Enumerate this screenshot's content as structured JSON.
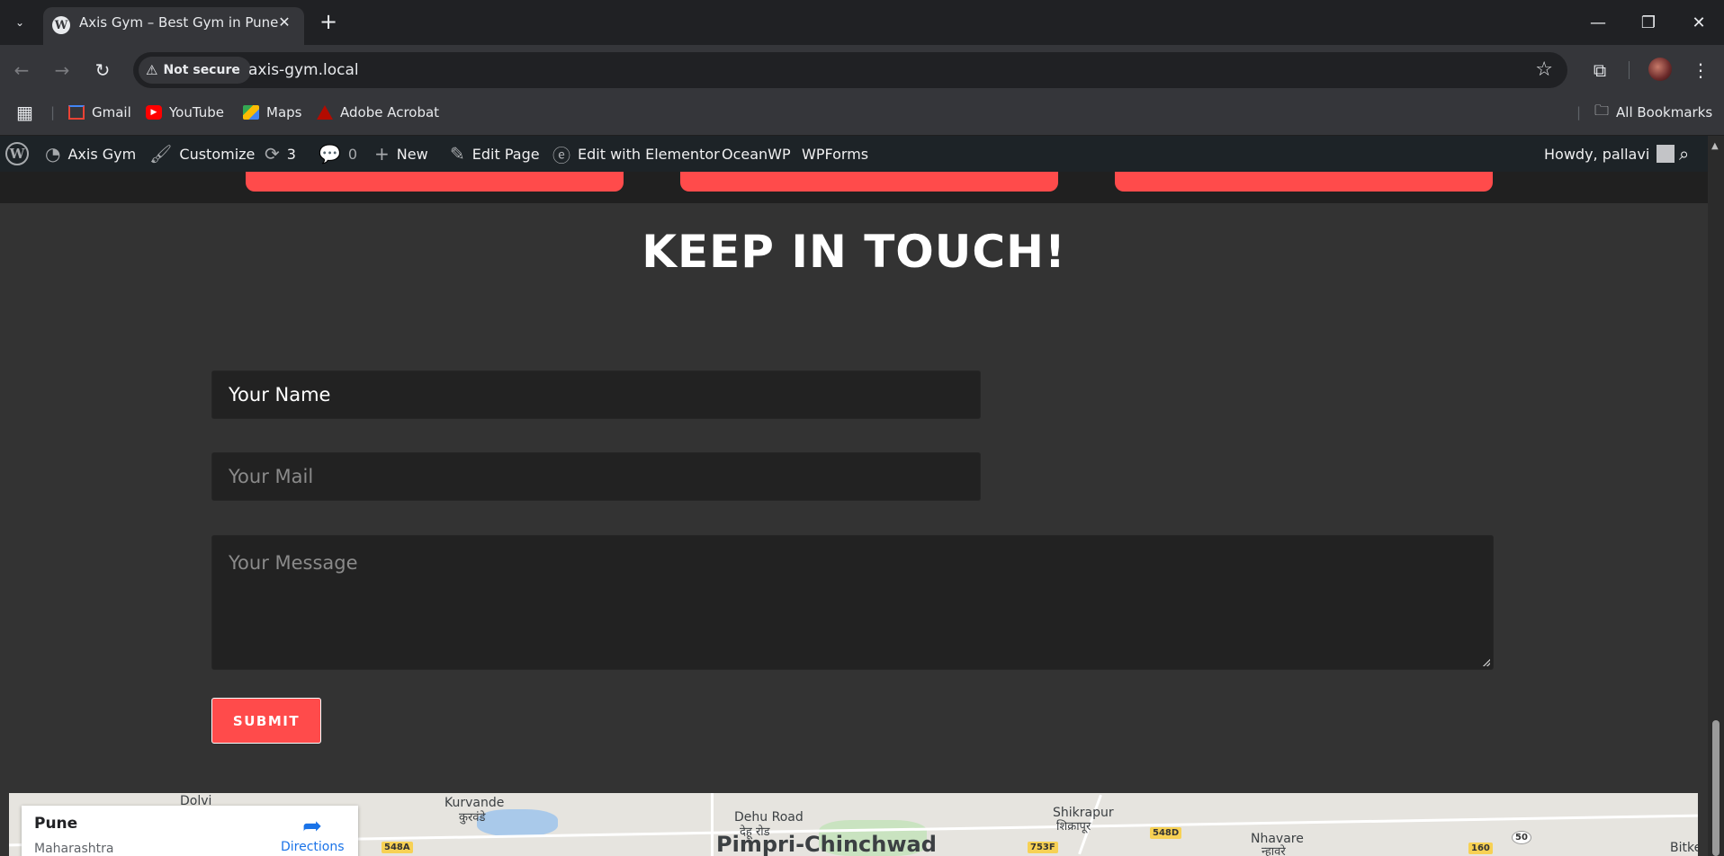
{
  "browser": {
    "tab": {
      "title": "Axis Gym – Best Gym in Pune",
      "favicon": "W"
    },
    "tab_list_icon": "⌄",
    "new_tab_icon": "+",
    "window_controls": {
      "minimize": "—",
      "restore": "❐",
      "close": "✕"
    },
    "security_chip": "Not secure",
    "url": "axis-gym.local",
    "bookmarks": [
      {
        "label": "Gmail",
        "color": "#ea4335"
      },
      {
        "label": "YouTube",
        "color": "#ff0000"
      },
      {
        "label": "Maps",
        "color": "#34a853"
      },
      {
        "label": "Adobe Acrobat",
        "color": "#e34850"
      }
    ],
    "all_bookmarks": "All Bookmarks"
  },
  "admin_bar": {
    "site_name": "Axis Gym",
    "customize": "Customize",
    "updates_count": "3",
    "comments_count": "0",
    "new": "New",
    "edit_page": "Edit Page",
    "edit_elementor": "Edit with Elementor",
    "oceanwp": "OceanWP",
    "wpforms": "WPForms",
    "howdy": "Howdy, pallavi"
  },
  "page": {
    "heading": "KEEP IN TOUCH!",
    "form": {
      "name_value": "Your Name",
      "mail_placeholder": "Your Mail",
      "message_placeholder": "Your Message",
      "submit_label": "SUBMIT"
    },
    "accent_color": "#ff4b4b"
  },
  "map": {
    "place_name": "Pune",
    "place_region": "Maharashtra",
    "directions_label": "Directions",
    "labels": {
      "kurvande": "Kurvande",
      "kurvande_mr": "कुरवंडे",
      "dehu_road": "Dehu Road",
      "dehu_road_mr": "देहू रोड",
      "shikrapur": "Shikrapur",
      "shikrapur_mr": "शिक्रापूर",
      "nhavare": "Nhavare",
      "nhavare_mr": "न्हावरे",
      "dolvi": "Dolvi",
      "pimpri": "Pimpri-Chinchwad",
      "bitke": "Bitke"
    },
    "shields": [
      "548A",
      "753F",
      "548D",
      "160",
      "50"
    ]
  }
}
